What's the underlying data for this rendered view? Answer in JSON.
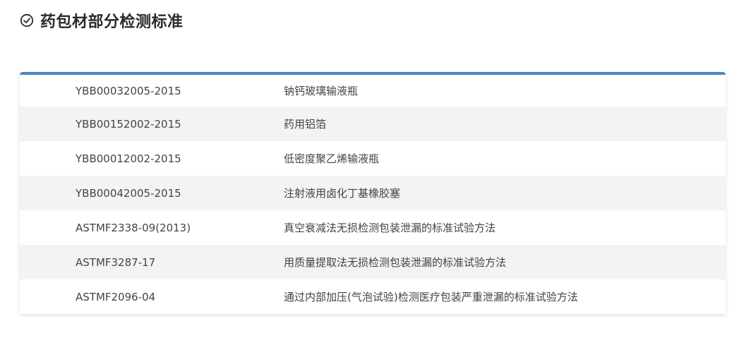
{
  "header": {
    "icon": "check-circle-icon",
    "title": "药包材部分检测标准"
  },
  "colors": {
    "accent": "#4a86c8",
    "row_alt": "#f3f3f3",
    "text": "#444444"
  },
  "table": {
    "rows": [
      {
        "code": "YBB00032005-2015",
        "name": "钠钙玻璃输液瓶"
      },
      {
        "code": "YBB00152002-2015",
        "name": "药用铝箔"
      },
      {
        "code": "YBB00012002-2015",
        "name": "低密度聚乙烯输液瓶"
      },
      {
        "code": "YBB00042005-2015",
        "name": "注射液用卤化丁基橡胶塞"
      },
      {
        "code": "ASTMF2338-09(2013)",
        "name": "真空衰减法无损检测包装泄漏的标准试验方法"
      },
      {
        "code": "ASTMF3287-17",
        "name": "用质量提取法无损检测包装泄漏的标准试验方法"
      },
      {
        "code": "ASTMF2096-04",
        "name": "通过内部加压(气泡试验)检测医疗包装严重泄漏的标准试验方法"
      }
    ]
  }
}
